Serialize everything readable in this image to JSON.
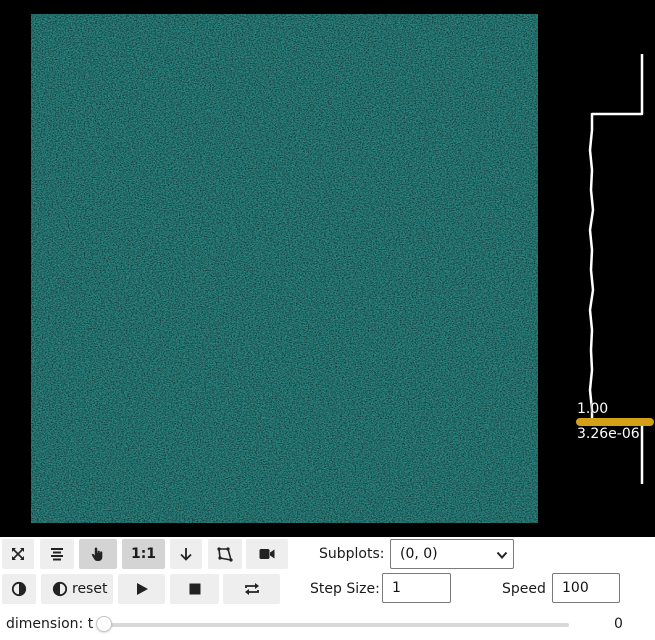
{
  "viewer": {
    "colormap": "viridis",
    "histogram": {
      "max_label": "1.00",
      "min_label": "3.26e-06"
    }
  },
  "toolbar": {
    "row1": {
      "buttons": [
        {
          "icon": "expand-icon",
          "label": ""
        },
        {
          "icon": "align-center-icon",
          "label": ""
        },
        {
          "icon": "pan-hand-icon",
          "label": "",
          "active": true
        },
        {
          "icon": "",
          "label": "1:1",
          "active": true
        },
        {
          "icon": "arrow-down-icon",
          "label": ""
        },
        {
          "icon": "crop-icon",
          "label": ""
        },
        {
          "icon": "video-camera-icon",
          "label": ""
        }
      ],
      "subplots_label": "Subplots:",
      "subplots_value": "(0, 0)"
    },
    "row2": {
      "buttons": [
        {
          "icon": "contrast-icon",
          "label": ""
        },
        {
          "icon": "contrast-icon",
          "label": "reset"
        },
        {
          "icon": "play-icon",
          "label": ""
        },
        {
          "icon": "stop-icon",
          "label": ""
        },
        {
          "icon": "loop-icon",
          "label": ""
        }
      ],
      "step_size_label": "Step Size:",
      "step_size_value": "1",
      "speed_label": "Speed",
      "speed_value": "100"
    },
    "row3": {
      "dimension_label": "dimension: t",
      "dimension_value": "0",
      "slider_fraction": 0
    }
  },
  "colors": {
    "background": "#000000",
    "histogram_line": "#ffffff",
    "histogram_bar": "#d4a017",
    "button_bg": "#eeeeee",
    "button_active_bg": "#d4d4d4"
  }
}
